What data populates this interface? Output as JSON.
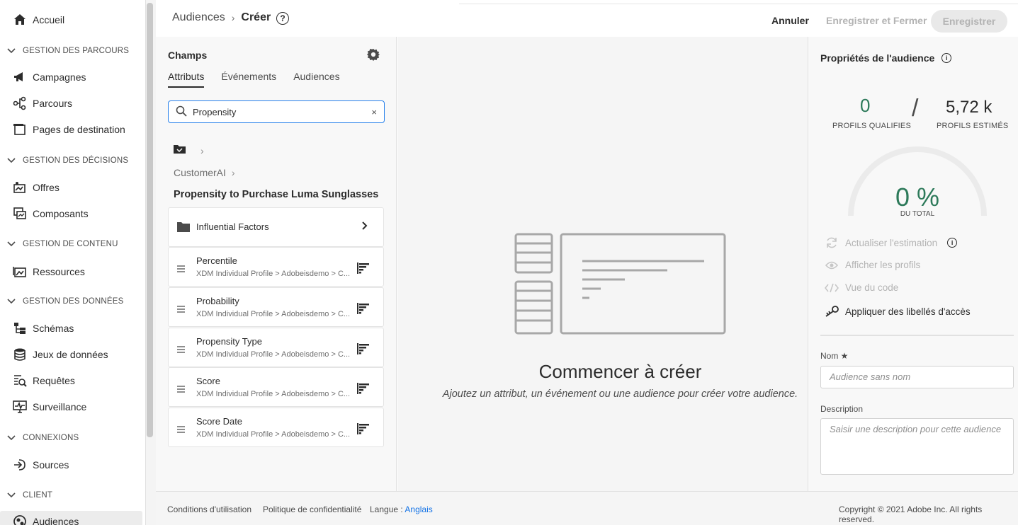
{
  "sidebar": {
    "home": "Accueil",
    "sections": [
      {
        "label": "GESTION DES PARCOURS",
        "items": [
          "Campagnes",
          "Parcours",
          "Pages de destination"
        ]
      },
      {
        "label": "GESTION DES DÉCISIONS",
        "items": [
          "Offres",
          "Composants"
        ]
      },
      {
        "label": "GESTION DE CONTENU",
        "items": [
          "Ressources"
        ]
      },
      {
        "label": "GESTION DES DONNÉES",
        "items": [
          "Schémas",
          "Jeux de données",
          "Requêtes",
          "Surveillance"
        ]
      },
      {
        "label": "CONNEXIONS",
        "items": [
          "Sources"
        ]
      },
      {
        "label": "CLIENT",
        "items": [
          "Audiences"
        ]
      }
    ]
  },
  "header": {
    "breadcrumb_parent": "Audiences",
    "breadcrumb_current": "Créer",
    "help": "?",
    "cancel": "Annuler",
    "save_close": "Enregistrer et Fermer",
    "save": "Enregistrer"
  },
  "fields": {
    "title": "Champs",
    "tabs": [
      "Attributs",
      "Événements",
      "Audiences"
    ],
    "search_value": "Propensity",
    "clear": "×",
    "path": "CustomerAI",
    "group_title": "Propensity to Purchase Luma Sunglasses",
    "folder": "Influential Factors",
    "items": [
      {
        "name": "Percentile",
        "path": "XDM Individual Profile > Adobeisdemo > C..."
      },
      {
        "name": "Probability",
        "path": "XDM Individual Profile > Adobeisdemo > C..."
      },
      {
        "name": "Propensity Type",
        "path": "XDM Individual Profile > Adobeisdemo > C..."
      },
      {
        "name": "Score",
        "path": "XDM Individual Profile > Adobeisdemo > C..."
      },
      {
        "name": "Score Date",
        "path": "XDM Individual Profile > Adobeisdemo > C..."
      }
    ]
  },
  "canvas": {
    "title": "Commencer à créer",
    "subtitle": "Ajoutez un attribut, un événement ou une audience pour créer votre audience."
  },
  "properties": {
    "title": "Propriétés de l'audience",
    "qualified_value": "0",
    "qualified_label": "PROFILS QUALIFIES",
    "estimated_value": "5,72 k",
    "estimated_label": "PROFILS ESTIMÉS",
    "gauge_value": "0 %",
    "gauge_fraction": 0,
    "gauge_label": "DU TOTAL",
    "actions": [
      "Actualiser l'estimation",
      "Afficher les profils",
      "Vue du code",
      "Appliquer des libellés d'accès"
    ],
    "name_label": "Nom ★",
    "name_placeholder": "Audience sans nom",
    "desc_label": "Description",
    "desc_placeholder": "Saisir une description pour cette audience"
  },
  "footer": {
    "terms": "Conditions d'utilisation",
    "privacy": "Politique de confidentialité",
    "lang_label": "Langue :",
    "lang_value": "Anglais",
    "copyright": "Copyright © 2021 Adobe Inc. All rights reserved."
  },
  "colors": {
    "accent": "#2680eb",
    "stat_green": "#2d7a5a",
    "disabled": "#b3b3b3"
  }
}
